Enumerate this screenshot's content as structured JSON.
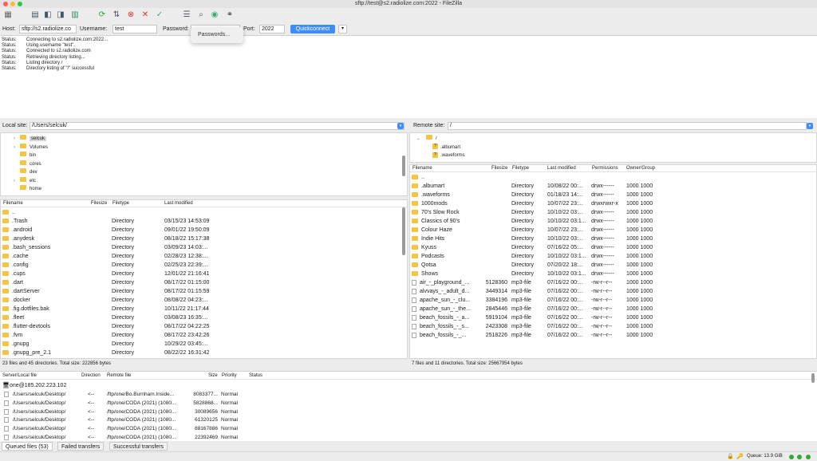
{
  "window": {
    "title": "sftp://test@s2.radiolize.com:2022 - FileZilla"
  },
  "quickconnect": {
    "host_label": "Host:",
    "host_value": "sftp://s2.radiolize.co",
    "username_label": "Username:",
    "username_value": "test",
    "password_label": "Password:",
    "port_label": "Port:",
    "port_value": "2022",
    "button_label": "Quickconnect",
    "dropdown_arrow": "▾",
    "popup_item": "Passwords..."
  },
  "log": [
    {
      "type": "Status:",
      "msg": "Connecting to s2.radiolize.com:2022..."
    },
    {
      "type": "Status:",
      "msg": "Using username \"test\"."
    },
    {
      "type": "Status:",
      "msg": "Connected to s2.radiolize.com"
    },
    {
      "type": "Status:",
      "msg": "Retrieving directory listing..."
    },
    {
      "type": "Status:",
      "msg": "Listing directory /"
    },
    {
      "type": "Status:",
      "msg": "Directory listing of \"/\" successful"
    }
  ],
  "local": {
    "site_label": "Local site:",
    "path": "/Users/selcuk/",
    "tree": [
      "selcuk",
      "Volumes",
      "bin",
      "cores",
      "dev",
      "etc",
      "home"
    ],
    "headers": {
      "name": "Filename",
      "size": "Filesize",
      "type": "Filetype",
      "modified": "Last modified"
    },
    "files": [
      {
        "name": "..",
        "type": "",
        "modified": ""
      },
      {
        "name": ".Trash",
        "type": "Directory",
        "modified": "03/15/23 14:53:09"
      },
      {
        "name": ".android",
        "type": "Directory",
        "modified": "09/01/22 19:50:09"
      },
      {
        "name": ".anydesk",
        "type": "Directory",
        "modified": "08/18/22 15:17:38"
      },
      {
        "name": ".bash_sessions",
        "type": "Directory",
        "modified": "03/09/23 14:03:..."
      },
      {
        "name": ".cache",
        "type": "Directory",
        "modified": "02/28/23 12:38:..."
      },
      {
        "name": ".config",
        "type": "Directory",
        "modified": "02/25/23 22:39:..."
      },
      {
        "name": ".cups",
        "type": "Directory",
        "modified": "12/01/22 21:16:41"
      },
      {
        "name": ".dart",
        "type": "Directory",
        "modified": "08/17/22 01:15:00"
      },
      {
        "name": ".dartServer",
        "type": "Directory",
        "modified": "08/17/22 01:15:59"
      },
      {
        "name": ".docker",
        "type": "Directory",
        "modified": "08/08/22 04:23:..."
      },
      {
        "name": ".fig.dotfiles.bak",
        "type": "Directory",
        "modified": "10/11/22 21:17:44"
      },
      {
        "name": ".fleet",
        "type": "Directory",
        "modified": "03/08/23 16:35:..."
      },
      {
        "name": ".flutter-devtools",
        "type": "Directory",
        "modified": "08/17/22 04:22:25"
      },
      {
        "name": ".fvm",
        "type": "Directory",
        "modified": "08/17/22 23:42:26"
      },
      {
        "name": ".gnupg",
        "type": "Directory",
        "modified": "10/29/22 03:45:..."
      },
      {
        "name": ".gnupg_pre_2.1",
        "type": "Directory",
        "modified": "08/22/22 16:31:42"
      }
    ],
    "status": "23 files and 45 directories. Total size: 222856 bytes"
  },
  "remote": {
    "site_label": "Remote site:",
    "path": "/",
    "tree": [
      "/",
      ".albumart",
      ".waveforms"
    ],
    "headers": {
      "name": "Filename",
      "size": "Filesize",
      "type": "Filetype",
      "modified": "Last modified",
      "perms": "Permissions",
      "owner": "Owner/Group"
    },
    "files": [
      {
        "name": "..",
        "size": "",
        "type": "",
        "modified": "",
        "perms": "",
        "owner": "",
        "dir": true
      },
      {
        "name": ".albumart",
        "size": "",
        "type": "Directory",
        "modified": "10/08/22 00:...",
        "perms": "drwx------",
        "owner": "1000 1000",
        "dir": true
      },
      {
        "name": ".waveforms",
        "size": "",
        "type": "Directory",
        "modified": "01/18/23 14:...",
        "perms": "drwx------",
        "owner": "1000 1000",
        "dir": true
      },
      {
        "name": "1000mods",
        "size": "",
        "type": "Directory",
        "modified": "10/07/22 23:...",
        "perms": "drwxrwxr-x",
        "owner": "1000 1000",
        "dir": true
      },
      {
        "name": "70's Slow Rock",
        "size": "",
        "type": "Directory",
        "modified": "10/10/22 03:...",
        "perms": "drwx------",
        "owner": "1000 1000",
        "dir": true
      },
      {
        "name": "Classics of 90's",
        "size": "",
        "type": "Directory",
        "modified": "10/10/22 03:1...",
        "perms": "drwx------",
        "owner": "1000 1000",
        "dir": true
      },
      {
        "name": "Colour Haze",
        "size": "",
        "type": "Directory",
        "modified": "10/07/22 23:...",
        "perms": "drwx------",
        "owner": "1000 1000",
        "dir": true
      },
      {
        "name": "Indie Hits",
        "size": "",
        "type": "Directory",
        "modified": "10/10/22 03:...",
        "perms": "drwx------",
        "owner": "1000 1000",
        "dir": true
      },
      {
        "name": "Kyuss",
        "size": "",
        "type": "Directory",
        "modified": "07/16/22 05:...",
        "perms": "drwx------",
        "owner": "1000 1000",
        "dir": true
      },
      {
        "name": "Podcasts",
        "size": "",
        "type": "Directory",
        "modified": "10/10/22 03:1...",
        "perms": "drwx------",
        "owner": "1000 1000",
        "dir": true
      },
      {
        "name": "Qotsa",
        "size": "",
        "type": "Directory",
        "modified": "07/20/22 18:...",
        "perms": "drwx------",
        "owner": "1000 1000",
        "dir": true
      },
      {
        "name": "Shows",
        "size": "",
        "type": "Directory",
        "modified": "10/10/22 03:1...",
        "perms": "drwx------",
        "owner": "1000 1000",
        "dir": true
      },
      {
        "name": "air_-_playground_...",
        "size": "5128360",
        "type": "mp3-file",
        "modified": "07/16/22 00:...",
        "perms": "-rw-r--r--",
        "owner": "1000 1000",
        "dir": false
      },
      {
        "name": "alvvays_-_adult_d...",
        "size": "3449314",
        "type": "mp3-file",
        "modified": "07/16/22 00:...",
        "perms": "-rw-r--r--",
        "owner": "1000 1000",
        "dir": false
      },
      {
        "name": "apache_sun_-_clu...",
        "size": "3384196",
        "type": "mp3-file",
        "modified": "07/16/22 00:...",
        "perms": "-rw-r--r--",
        "owner": "1000 1000",
        "dir": false
      },
      {
        "name": "apache_sun_-_the...",
        "size": "2845446",
        "type": "mp3-file",
        "modified": "07/16/22 00:...",
        "perms": "-rw-r--r--",
        "owner": "1000 1000",
        "dir": false
      },
      {
        "name": "beach_fossils_-_a...",
        "size": "5919104",
        "type": "mp3-file",
        "modified": "07/16/22 00:...",
        "perms": "-rw-r--r--",
        "owner": "1000 1000",
        "dir": false
      },
      {
        "name": "beach_fossils_-_s...",
        "size": "2423308",
        "type": "mp3-file",
        "modified": "07/16/22 00:...",
        "perms": "-rw-r--r--",
        "owner": "1000 1000",
        "dir": false
      },
      {
        "name": "beach_fossils_-_...",
        "size": "2518226",
        "type": "mp3-file",
        "modified": "07/16/22 00:...",
        "perms": "-rw-r--r--",
        "owner": "1000 1000",
        "dir": false
      }
    ],
    "status": "7 files and 11 directories. Total size: 25667954 bytes"
  },
  "queue": {
    "headers": {
      "local": "Server/Local file",
      "direction": "Direction",
      "remote": "Remote file",
      "size": "Size",
      "priority": "Priority",
      "status": "Status"
    },
    "server": "one@185.202.223.102",
    "items": [
      {
        "local": "/Users/selcuk/Desktop/",
        "dir": "<--",
        "remote": "/ftp/one/Bo.Burnham.Inside...",
        "size": "8083377...",
        "priority": "Normal"
      },
      {
        "local": "/Users/selcuk/Desktop/",
        "dir": "<--",
        "remote": "/ftp/one/CODA (2021) (1080...",
        "size": "5828868...",
        "priority": "Normal"
      },
      {
        "local": "/Users/selcuk/Desktop/",
        "dir": "<--",
        "remote": "/ftp/one/CODA (2021) (1080...",
        "size": "30089656",
        "priority": "Normal"
      },
      {
        "local": "/Users/selcuk/Desktop/",
        "dir": "<--",
        "remote": "/ftp/one/CODA (2021) (1080...",
        "size": "61320125",
        "priority": "Normal"
      },
      {
        "local": "/Users/selcuk/Desktop/",
        "dir": "<--",
        "remote": "/ftp/one/CODA (2021) (1080...",
        "size": "88167886",
        "priority": "Normal"
      },
      {
        "local": "/Users/selcuk/Desktop/",
        "dir": "<--",
        "remote": "/ftp/one/CODA (2021) (1080...",
        "size": "22392469",
        "priority": "Normal"
      }
    ]
  },
  "tabs": [
    "Queued files (53)",
    "Failed transfers",
    "Successful transfers"
  ],
  "statusbar": {
    "queue": "Queue: 13.9 GiB"
  },
  "colors": {
    "accent": "#3f8ef5",
    "folder": "#f4c443"
  }
}
